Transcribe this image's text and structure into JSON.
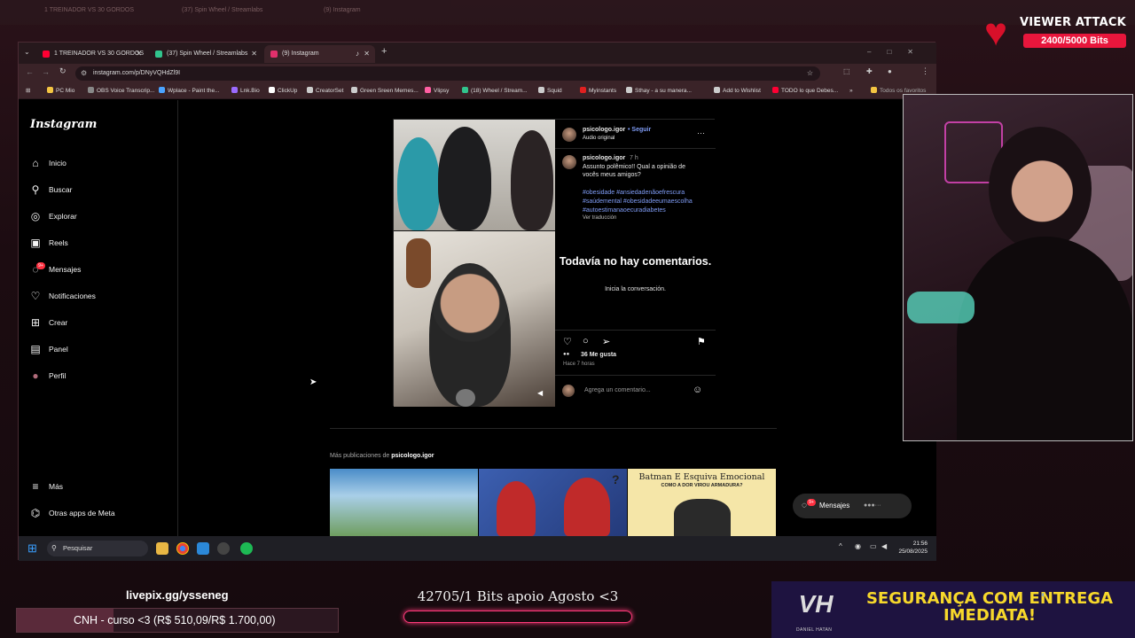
{
  "background_tabs": [
    "1 TREINADOR VS 30 GORDOS",
    "(37) Spin Wheel / Streamlabs",
    "(9) Instagram"
  ],
  "viewer_attack": {
    "title": "VIEWER ATTACK",
    "progress": "2400/5000 Bits"
  },
  "browser": {
    "tabs": [
      {
        "label": "1 TREINADOR VS 30 GORDOS",
        "color": "#ff0033"
      },
      {
        "label": "(37) Spin Wheel / Streamlabs",
        "color": "#31c48d"
      },
      {
        "label": "(9) Instagram",
        "color": "#e1306c"
      }
    ],
    "new_tab": "+",
    "url": "instagram.com/p/DNyVQHdZl9I",
    "bookmarks": [
      {
        "label": "PC Mio",
        "color": "#f4c542"
      },
      {
        "label": "OBS Voice Transcrip...",
        "color": "#888888"
      },
      {
        "label": "Wplace - Paint the...",
        "color": "#4aa3ff"
      },
      {
        "label": "Lnk.Bio",
        "color": "#9b6bff"
      },
      {
        "label": "ClickUp",
        "color": "#ffffff"
      },
      {
        "label": "CreatorSet",
        "color": "#cccccc"
      },
      {
        "label": "Green Sreen Memes...",
        "color": "#cccccc"
      },
      {
        "label": "Vlipsy",
        "color": "#ff5fa2"
      },
      {
        "label": "(18) Wheel / Stream...",
        "color": "#31c48d"
      },
      {
        "label": "Squid",
        "color": "#cccccc"
      },
      {
        "label": "Myinstants",
        "color": "#e02020"
      },
      {
        "label": "Sthay - a su manera...",
        "color": "#cccccc"
      },
      {
        "label": "Add to Wishlist",
        "color": "#cccccc"
      },
      {
        "label": "TODO lo que Debes...",
        "color": "#ff0033"
      }
    ],
    "bookmarks_more": "»",
    "all_favorites": "Todos os favoritos"
  },
  "instagram": {
    "logo": "Instagram",
    "nav": [
      {
        "label": "Inicio",
        "icon": "home-icon",
        "glyph": "⌂"
      },
      {
        "label": "Buscar",
        "icon": "search-icon",
        "glyph": "⚲"
      },
      {
        "label": "Explorar",
        "icon": "compass-icon",
        "glyph": "◎"
      },
      {
        "label": "Reels",
        "icon": "reels-icon",
        "glyph": "▣"
      },
      {
        "label": "Mensajes",
        "icon": "messenger-icon",
        "glyph": "◌"
      },
      {
        "label": "Notificaciones",
        "icon": "heart-icon",
        "glyph": "♡"
      },
      {
        "label": "Crear",
        "icon": "plus-square-icon",
        "glyph": "⊞"
      },
      {
        "label": "Panel",
        "icon": "dashboard-icon",
        "glyph": "▤"
      },
      {
        "label": "Perfil",
        "icon": "avatar-icon",
        "glyph": "●"
      }
    ],
    "messages_badge": "9+",
    "more": "Más",
    "meta_apps": "Otras apps de Meta",
    "post": {
      "username": "psicologo.igor",
      "follow": "• Seguir",
      "audio": "Audio original",
      "menu": "···",
      "caption_user": "psicologo.igor",
      "caption_time": "7 h",
      "caption_lines": [
        "Assunto polêmico!! Qual a opinião de",
        "vocês meus amigos?"
      ],
      "hashtags": [
        "#obesidade #ansiedadenãoefrescura",
        "#saúdemental #obesidadeeumaescolha",
        "#autoestimanaoecuradiabetes"
      ],
      "translate": "Ver traducción",
      "no_comments_title": "Todavía no hay comentarios.",
      "no_comments_sub": "Inicia la conversación.",
      "likes": "36 Me gusta",
      "time_ago": "Hace 7 horas",
      "comment_placeholder": "Agrega un comentario..."
    },
    "more_posts_prefix": "Más publicaciones de ",
    "more_posts_user": "psicologo.igor",
    "thumb3_title": "Batman E Esquiva Emocional",
    "thumb3_sub": "COMO A DOR VIROU ARMADURA?",
    "chat_label": "Mensajes",
    "chat_badge": "9+"
  },
  "taskbar": {
    "search": "Pesquisar",
    "time": "21:56",
    "date": "25/08/2025"
  },
  "overlays": {
    "livepix": "livepix.gg/ysseneg",
    "cnh": "CNH - curso <3 (R$ 510,09/R$ 1.700,00)",
    "cnh_progress": 0.3,
    "bits_goal": "42705/1 Bits apoio Agosto <3",
    "ad_text": "SEGURANÇA COM ENTREGA IMEDIATA!",
    "ad_brand": "DANIEL HATAN",
    "ad_logo": "VH"
  }
}
